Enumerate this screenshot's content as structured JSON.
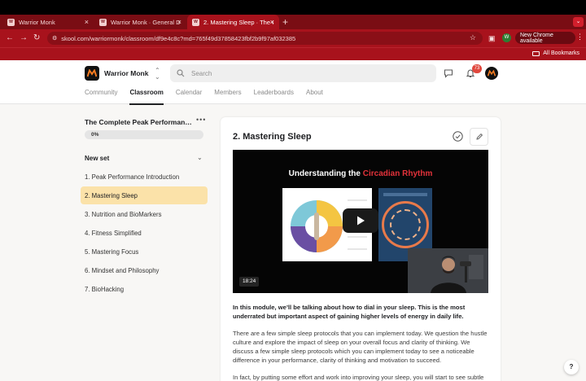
{
  "browser": {
    "tabs": [
      {
        "favicon": "W",
        "title": "Warrior Monk"
      },
      {
        "favicon": "W",
        "title": "Warrior Monk · General Disc…"
      },
      {
        "favicon": "W",
        "title": "2. Mastering Sleep · The Com…"
      }
    ],
    "url": "skool.com/warriormonk/classroom/df9e4c8c?md=765f49d37858423fbf2b9f97af032385",
    "profile_initial": "W",
    "update_label": "New Chrome available",
    "bookmarks_label": "All Bookmarks",
    "colors": {
      "tabstrip": "#7a0d14",
      "toolbar": "#a8121c"
    }
  },
  "header": {
    "brand": "Warrior Monk",
    "search_placeholder": "Search",
    "notification_count": "73",
    "nav": [
      "Community",
      "Classroom",
      "Calendar",
      "Members",
      "Leaderboards",
      "About"
    ],
    "active_nav": "Classroom"
  },
  "sidebar": {
    "course_title": "The Complete Peak Performanc…",
    "progress_label": "0%",
    "progress_value": 0,
    "set_title": "New set",
    "lessons": [
      "1. Peak Performance Introduction",
      "2. Mastering Sleep",
      "3. Nutrition and BioMarkers",
      "4. Fitness Simplified",
      "5. Mastering Focus",
      "6. Mindset and Philosophy",
      "7. BioHacking"
    ],
    "active_lesson": "2. Mastering Sleep"
  },
  "main": {
    "title": "2. Mastering Sleep",
    "video": {
      "slide_title_prefix": "Understanding the ",
      "slide_title_accent": "Circadian Rhythm",
      "duration": "18:24",
      "accent_color": "#e3323a"
    },
    "intro_bold": "In this module, we’ll be talking about how to dial in your sleep. This is the most underrated but important aspect of gaining higher levels of energy in daily life.",
    "para1": "There are a few simple sleep protocols that you can implement today. We question the hustle culture and explore the impact of sleep on your overall focus and clarity of thinking. We discuss a few simple sleep protocols which you can implement today to see a noticeable difference in your performance, clarity of thinking and motivation to succeed.",
    "para2": "In fact, by putting some effort and work into improving your sleep, you will start to see subtle"
  },
  "help_label": "?"
}
